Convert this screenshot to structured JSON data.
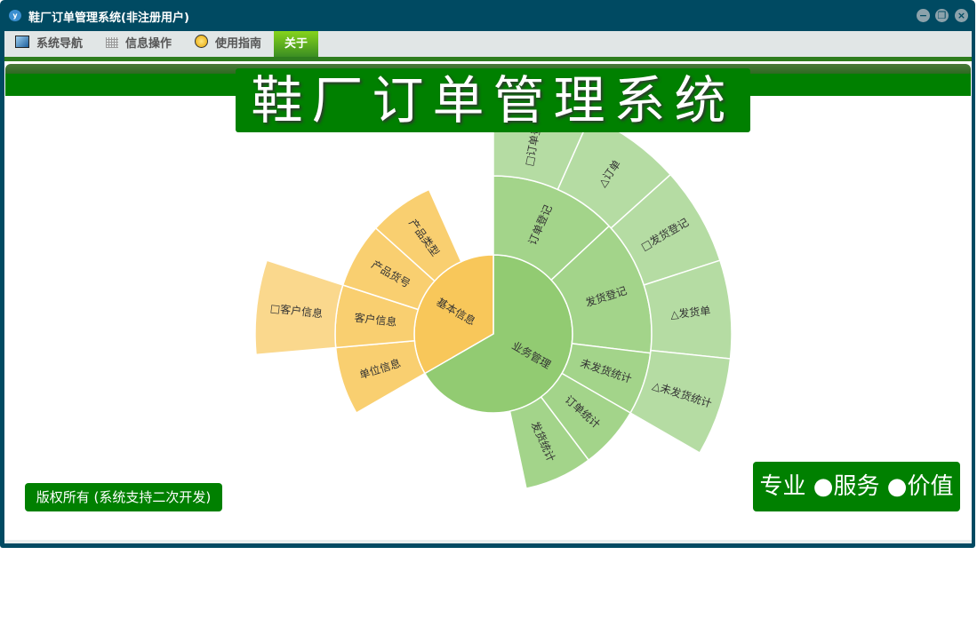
{
  "window": {
    "title": "鞋厂订单管理系统(非注册用户)",
    "app_icon_letter": "y",
    "controls": [
      "minimize",
      "restore",
      "close"
    ]
  },
  "menu": [
    {
      "label": "系统导航",
      "icon": "monitor-icon"
    },
    {
      "label": "信息操作",
      "icon": "grid-icon"
    },
    {
      "label": "使用指南",
      "icon": "help-icon"
    },
    {
      "label": "关于",
      "icon": "",
      "active": true
    }
  ],
  "banner": {
    "title": "鞋厂订单管理系统"
  },
  "footer": {
    "copyright": "版权所有 (系统支持二次开发)",
    "slogan": "专业 ●服务 ●价值"
  },
  "colors": {
    "titlebar": "#004A62",
    "green": "#008000",
    "yellow_inner": "#F8C75A",
    "yellow_mid": "#F9CF70",
    "yellow_outer": "#FAD88D",
    "green_inner": "#92CB72",
    "green_mid": "#A3D48A",
    "green_outer": "#B5DCA3"
  },
  "chart_data": {
    "type": "sunburst",
    "rings": [
      {
        "level": 1,
        "segments": [
          {
            "label": "业务管理",
            "start_deg": -90,
            "end_deg": 150,
            "group": "green"
          },
          {
            "label": "基本信息",
            "start_deg": 150,
            "end_deg": 270,
            "group": "yellow"
          }
        ]
      },
      {
        "level": 2,
        "segments": [
          {
            "label": "订单登记",
            "start_deg": -90,
            "end_deg": -43,
            "group": "green"
          },
          {
            "label": "发货登记",
            "start_deg": -43,
            "end_deg": 7,
            "group": "green"
          },
          {
            "label": "未发货统计",
            "start_deg": 7,
            "end_deg": 30,
            "group": "green"
          },
          {
            "label": "订单统计",
            "start_deg": 30,
            "end_deg": 53,
            "group": "green"
          },
          {
            "label": "发货统计",
            "start_deg": 53,
            "end_deg": 78,
            "group": "green"
          },
          {
            "label": "单位信息",
            "start_deg": 150,
            "end_deg": 175,
            "group": "yellow"
          },
          {
            "label": "客户信息",
            "start_deg": 175,
            "end_deg": 198,
            "group": "yellow"
          },
          {
            "label": "产品货号",
            "start_deg": 198,
            "end_deg": 222,
            "group": "yellow"
          },
          {
            "label": "产品类型",
            "start_deg": 222,
            "end_deg": 246,
            "group": "yellow"
          }
        ]
      },
      {
        "level": 3,
        "segments": [
          {
            "label": "□订单登记",
            "start_deg": -90,
            "end_deg": -66,
            "group": "green"
          },
          {
            "label": "△订单",
            "start_deg": -66,
            "end_deg": -42,
            "group": "green"
          },
          {
            "label": "□发货登记",
            "start_deg": -42,
            "end_deg": -18,
            "group": "green"
          },
          {
            "label": "△发货单",
            "start_deg": -18,
            "end_deg": 6,
            "group": "green"
          },
          {
            "label": "△未发货统计",
            "start_deg": 6,
            "end_deg": 30,
            "group": "green"
          },
          {
            "label": "□客户信息",
            "start_deg": 175,
            "end_deg": 198,
            "group": "yellow"
          }
        ]
      }
    ]
  }
}
